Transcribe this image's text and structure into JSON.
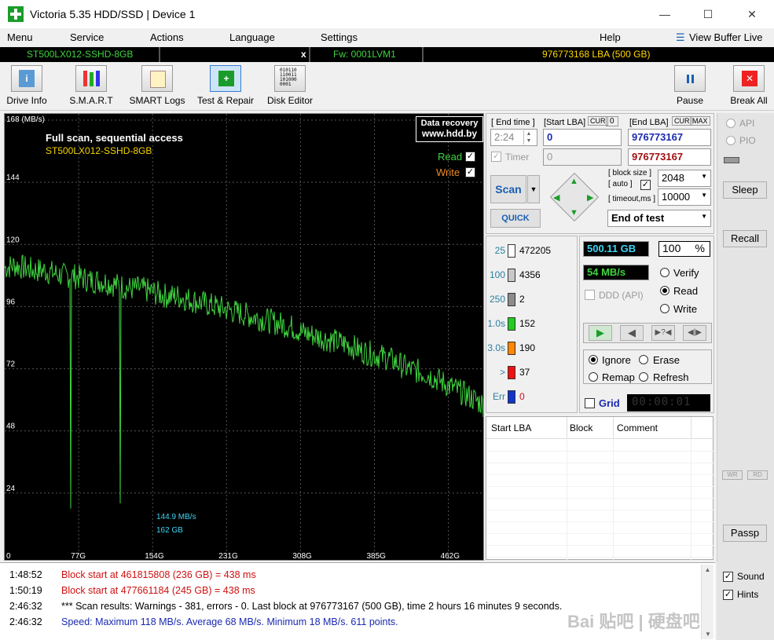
{
  "window": {
    "title": "Victoria 5.35 HDD/SSD | Device 1"
  },
  "menu": {
    "items": [
      "Menu",
      "Service",
      "Actions",
      "Language",
      "Settings",
      "Help"
    ],
    "view_buffer": "View Buffer Live"
  },
  "infobar": {
    "model": "ST500LX012-SSHD-8GB",
    "close": "x",
    "firmware": "Fw: 0001LVM1",
    "capacity": "976773168 LBA (500 GB)"
  },
  "toolbar": {
    "drive_info": "Drive Info",
    "smart": "S.M.A.R.T",
    "smart_logs": "SMART Logs",
    "test_repair": "Test & Repair",
    "disk_editor": "Disk Editor",
    "pause": "Pause",
    "break_all": "Break All"
  },
  "graph": {
    "unit": "168 (MB/s)",
    "title": "Full scan, sequential access",
    "model": "ST500LX012-SSHD-8GB",
    "recovery_line1": "Data recovery",
    "recovery_line2": "www.hdd.by",
    "read_label": "Read",
    "write_label": "Write",
    "cursor_speed": "144.9 MB/s",
    "cursor_pos": "162 GB"
  },
  "chart_data": {
    "type": "line",
    "title": "Full scan, sequential access",
    "ylabel": "(MB/s)",
    "ylim": [
      0,
      168
    ],
    "yticks": [
      24,
      48,
      72,
      96,
      120,
      144,
      168
    ],
    "xticks": [
      "0",
      "77G",
      "154G",
      "231G",
      "308G",
      "385G",
      "462G"
    ],
    "xlim_gb": [
      0,
      500
    ],
    "series": [
      {
        "name": "Read",
        "x": [
          0,
          10,
          20,
          30,
          40,
          50,
          60,
          70,
          80,
          90,
          100,
          110,
          120,
          130,
          140,
          150,
          160,
          170,
          180,
          190,
          200,
          210,
          220,
          230,
          240,
          250,
          260,
          270,
          280,
          290,
          300,
          310,
          320,
          330,
          340,
          350,
          360,
          370,
          380,
          390,
          400,
          410,
          420,
          430,
          440,
          450,
          460,
          470,
          480,
          490,
          500
        ],
        "values": [
          111,
          112,
          111,
          110,
          110,
          109,
          108,
          108,
          107,
          106,
          106,
          105,
          104,
          103,
          103,
          102,
          101,
          100,
          100,
          99,
          98,
          97,
          96,
          95,
          94,
          93,
          92,
          91,
          90,
          89,
          88,
          86,
          85,
          84,
          83,
          82,
          81,
          79,
          78,
          77,
          76,
          74,
          72,
          71,
          70,
          68,
          66,
          64,
          62,
          60,
          58
        ]
      }
    ],
    "dips_gb": [
      {
        "x": 69,
        "y": 18
      },
      {
        "x": 120,
        "y": 20
      }
    ]
  },
  "controls": {
    "end_time_label": "[ End time ]",
    "end_time": "2:24",
    "start_lba_label": "[Start LBA]",
    "cur1": "CUR",
    "cur1_val": "0",
    "end_lba_label": "[End LBA]",
    "cur2": "CUR",
    "max": "MAX",
    "start_lba": "0",
    "end_lba": "976773167",
    "timer_label": "Timer",
    "timer_val": "0",
    "end_lba2": "976773167",
    "block_size_label": "[ block size ]",
    "auto_label": "[ auto ]",
    "block_size": "2048",
    "timeout_label": "[ timeout,ms ]",
    "timeout": "10000",
    "scan": "Scan",
    "quick": "QUICK",
    "end_of_test": "End of test"
  },
  "stats": {
    "blocks": [
      {
        "label": "25",
        "count": "472205",
        "color": "#ffffff"
      },
      {
        "label": "100",
        "count": "4356",
        "color": "#c8c8c8"
      },
      {
        "label": "250",
        "count": "2",
        "color": "#8c8c8c"
      },
      {
        "label": "1.0s",
        "count": "152",
        "color": "#22cc22"
      },
      {
        "label": "3.0s",
        "count": "190",
        "color": "#ff8800"
      },
      {
        "label": ">",
        "count": "37",
        "color": "#ee1111"
      },
      {
        "label": "Err",
        "count": "0",
        "color": "#1133cc"
      }
    ],
    "gb_done": "500.11 GB",
    "percent": "100",
    "percent_sign": "%",
    "speed": "54 MB/s",
    "ddd": "DDD (API)",
    "verify": "Verify",
    "read": "Read",
    "write": "Write",
    "ignore": "Ignore",
    "erase": "Erase",
    "remap": "Remap",
    "refresh": "Refresh",
    "grid": "Grid",
    "timer": "00:00:01"
  },
  "table": {
    "headers": [
      "Start LBA",
      "Block",
      "Comment"
    ]
  },
  "side": {
    "api": "API",
    "pio": "PIO",
    "sleep": "Sleep",
    "recall": "Recall",
    "wr": "WR",
    "rd": "RD",
    "passp": "Passp",
    "sound": "Sound",
    "hints": "Hints"
  },
  "log": [
    {
      "time": "1:48:52",
      "text": "Block start at 461815808 (236 GB)  = 438 ms",
      "color": "#d01010"
    },
    {
      "time": "1:50:19",
      "text": "Block start at 477661184 (245 GB)  = 438 ms",
      "color": "#d01010"
    },
    {
      "time": "2:46:32",
      "text": "*** Scan results: Warnings - 381, errors - 0. Last block at 976773167 (500 GB), time 2 hours 16 minutes 9 seconds.",
      "color": "#000000"
    },
    {
      "time": "2:46:32",
      "text": "Speed: Maximum 118 MB/s. Average 68 MB/s. Minimum 18 MB/s. 611 points.",
      "color": "#1a2ab0"
    }
  ],
  "watermark": "Bai 贴吧 | 硬盘吧"
}
